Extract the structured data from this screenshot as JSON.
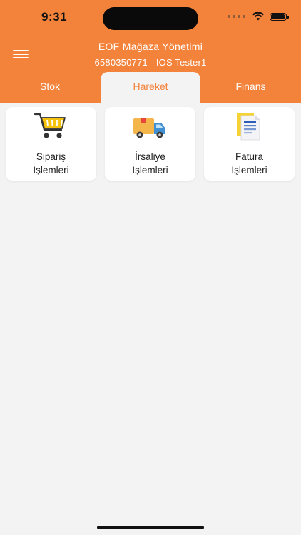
{
  "status_bar": {
    "time": "9:31"
  },
  "header": {
    "title": "EOF Mağaza Yönetimi",
    "store_code": "6580350771",
    "user_name": "IOS Tester1"
  },
  "tabs": [
    {
      "label": "Stok",
      "active": false
    },
    {
      "label": "Hareket",
      "active": true
    },
    {
      "label": "Finans",
      "active": false
    }
  ],
  "cards": [
    {
      "line1": "Sipariş",
      "line2": "İşlemleri",
      "icon": "shopping-cart-icon"
    },
    {
      "line1": "İrsaliye",
      "line2": "İşlemleri",
      "icon": "delivery-truck-icon"
    },
    {
      "line1": "Fatura",
      "line2": "İşlemleri",
      "icon": "invoice-document-icon"
    }
  ],
  "colors": {
    "accent": "#f3823a",
    "background": "#f4f3f3",
    "card": "#ffffff"
  }
}
